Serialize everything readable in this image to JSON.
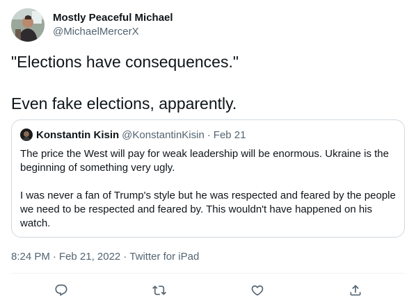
{
  "tweet": {
    "author": {
      "name": "Mostly Peaceful Michael",
      "handle": "@MichaelMercerX"
    },
    "text_lines": [
      "\"Elections have consequences.\"",
      "",
      "Even fake elections, apparently."
    ],
    "timestamp": "8:24 PM",
    "date": "Feb 21, 2022",
    "source": "Twitter for iPad"
  },
  "quote": {
    "author": {
      "name": "Konstantin Kisin",
      "handle": "@KonstantinKisin"
    },
    "date": "Feb 21",
    "body_lines": [
      "The price the West will pay for weak leadership will be enormous. Ukraine is the",
      "beginning of something very ugly.",
      "",
      "I was never a fan of Trump's style but he was respected and feared by the people",
      "we need to be respected and feared by. This wouldn't have happened on his",
      "watch."
    ]
  },
  "actions": [
    {
      "icon": "reply-icon"
    },
    {
      "icon": "retweet-icon"
    },
    {
      "icon": "like-icon"
    },
    {
      "icon": "share-icon"
    }
  ],
  "colors": {
    "primary_text": "#0f1419",
    "secondary_text": "#536471",
    "border": "#cfd9de"
  }
}
